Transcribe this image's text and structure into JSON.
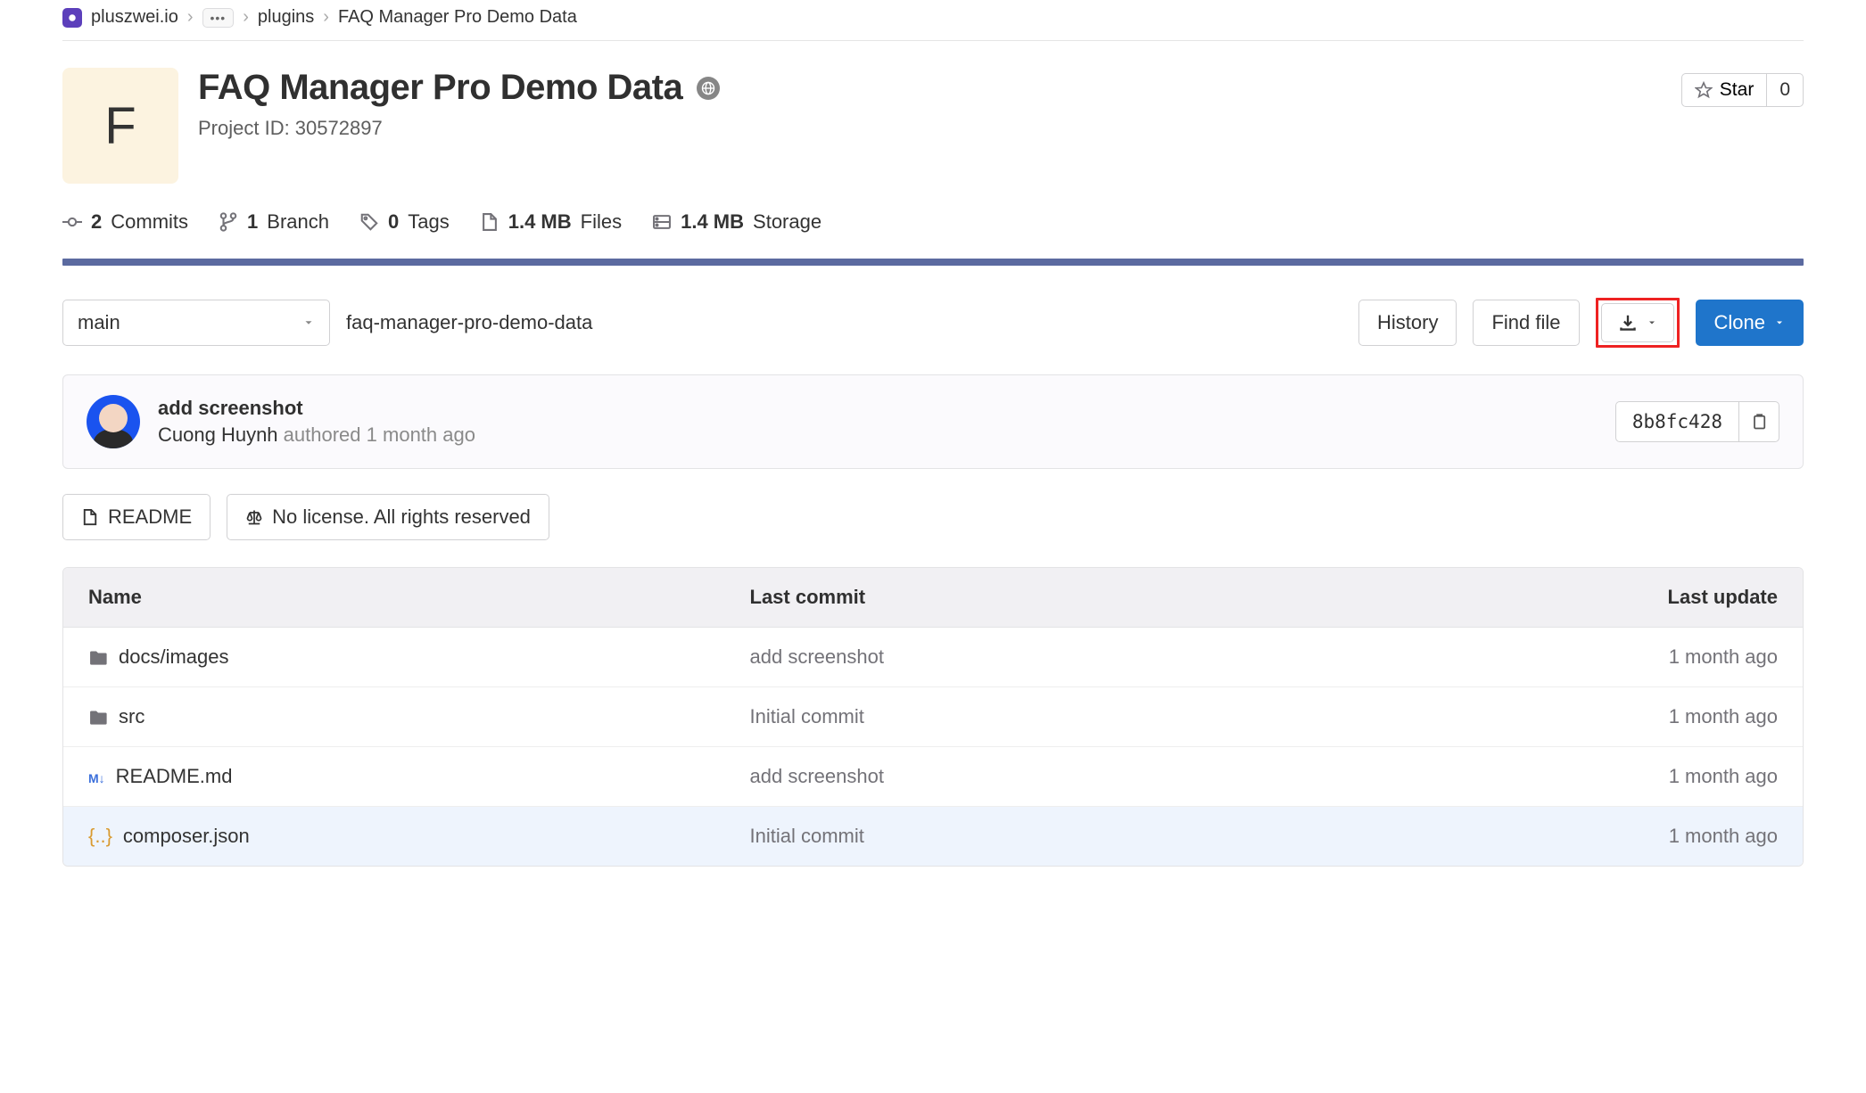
{
  "breadcrumbs": {
    "org": "pluszwei.io",
    "group": "plugins",
    "project": "FAQ Manager Pro Demo Data"
  },
  "project": {
    "avatar_letter": "F",
    "title": "FAQ Manager Pro Demo Data",
    "id_label": "Project ID: 30572897"
  },
  "star": {
    "label": "Star",
    "count": "0"
  },
  "stats": {
    "commits_count": "2",
    "commits_label": "Commits",
    "branches_count": "1",
    "branches_label": "Branch",
    "tags_count": "0",
    "tags_label": "Tags",
    "files_size": "1.4 MB",
    "files_label": "Files",
    "storage_size": "1.4 MB",
    "storage_label": "Storage"
  },
  "controls": {
    "branch": "main",
    "path": "faq-manager-pro-demo-data",
    "history": "History",
    "find_file": "Find file",
    "clone": "Clone"
  },
  "last_commit": {
    "title": "add screenshot",
    "author": "Cuong Huynh",
    "authored_word": "authored",
    "time": "1 month ago",
    "sha": "8b8fc428"
  },
  "meta": {
    "readme": "README",
    "license": "No license. All rights reserved"
  },
  "table": {
    "headers": {
      "name": "Name",
      "commit": "Last commit",
      "update": "Last update"
    },
    "rows": [
      {
        "type": "folder",
        "name": "docs/images",
        "commit": "add screenshot",
        "update": "1 month ago"
      },
      {
        "type": "folder",
        "name": "src",
        "commit": "Initial commit",
        "update": "1 month ago"
      },
      {
        "type": "md",
        "name": "README.md",
        "commit": "add screenshot",
        "update": "1 month ago"
      },
      {
        "type": "json",
        "name": "composer.json",
        "commit": "Initial commit",
        "update": "1 month ago"
      }
    ]
  }
}
